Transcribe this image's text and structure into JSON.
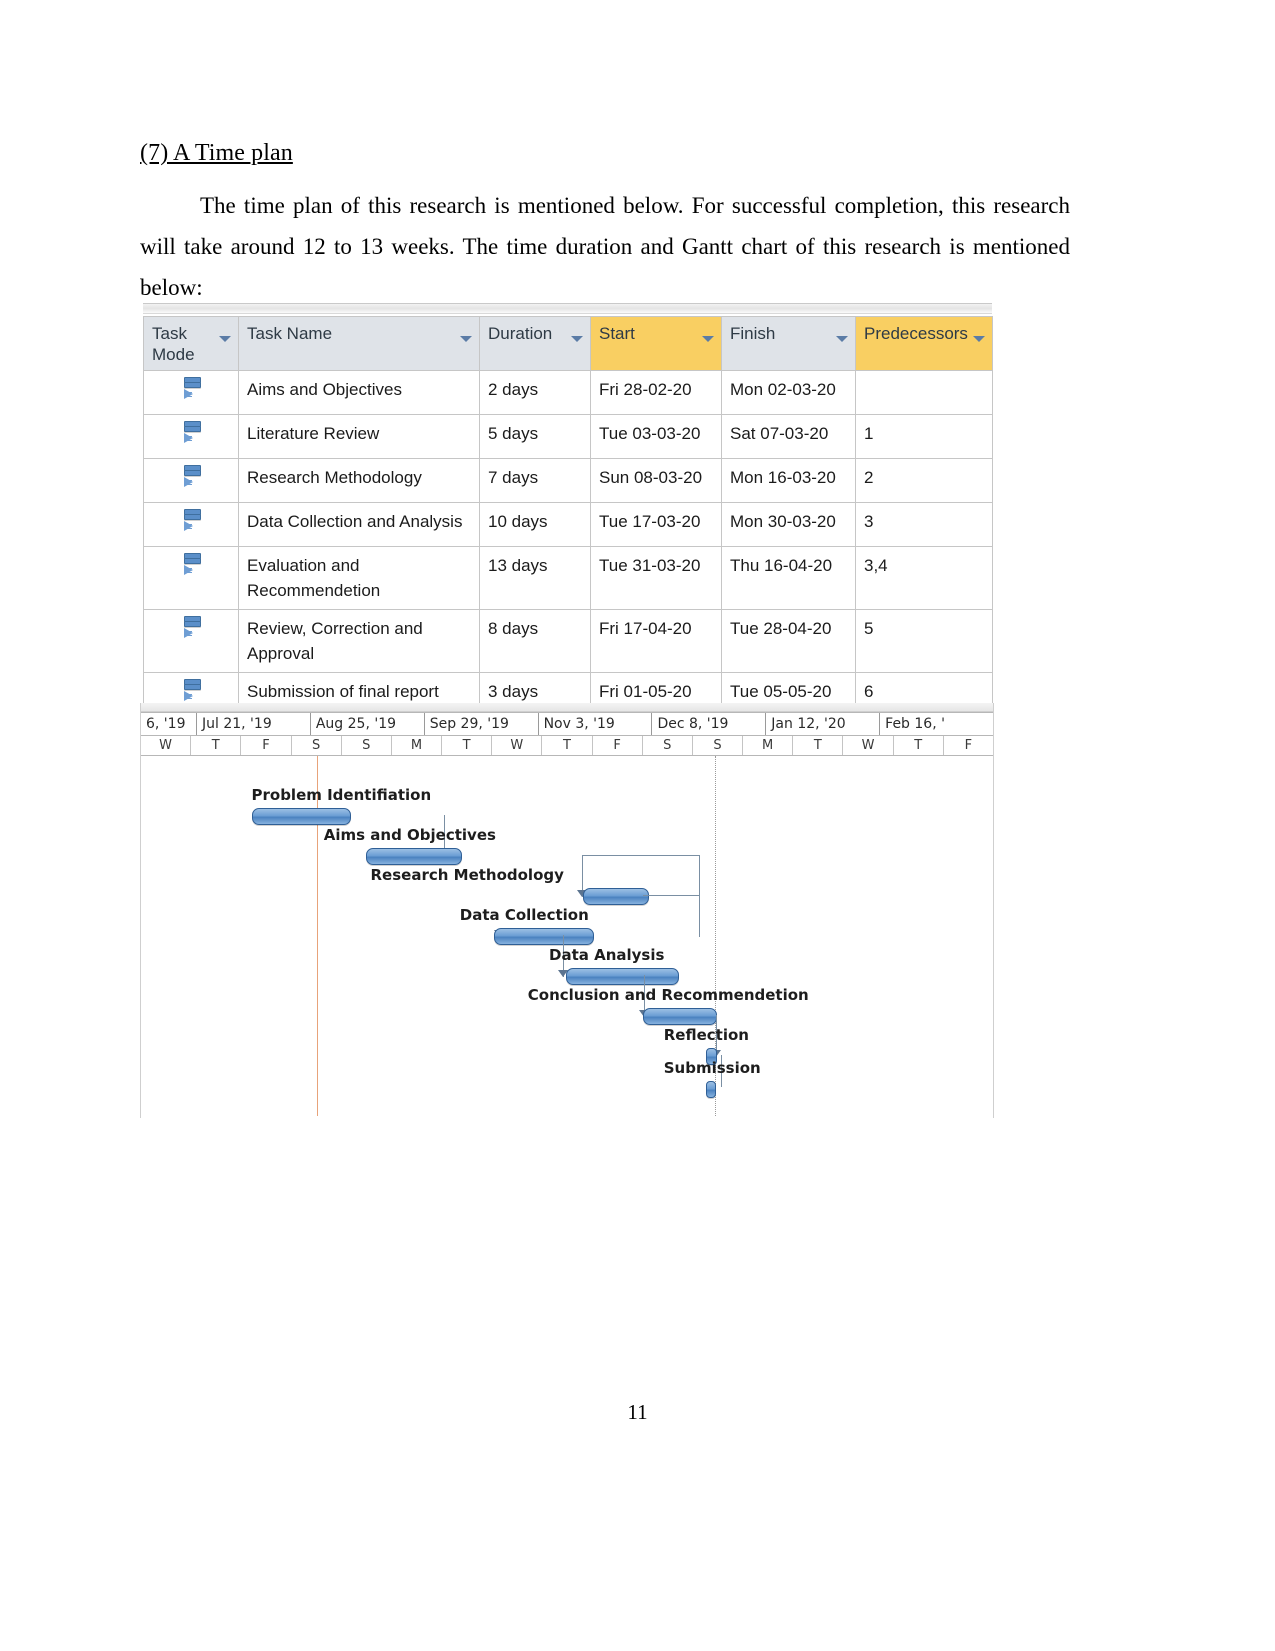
{
  "document": {
    "heading": "(7) A Time plan",
    "paragraph": "The time plan of this research is mentioned below. For successful completion, this research will take around 12 to 13 weeks. The time duration and Gantt chart of this research is mentioned below:",
    "page_number": "11"
  },
  "task_table": {
    "columns": [
      {
        "label": "Task Mode",
        "highlighted": false
      },
      {
        "label": "Task Name",
        "highlighted": false
      },
      {
        "label": "Duration",
        "highlighted": false
      },
      {
        "label": "Start",
        "highlighted": true
      },
      {
        "label": "Finish",
        "highlighted": false
      },
      {
        "label": "Predecessors",
        "highlighted": true
      }
    ],
    "rows": [
      {
        "mode_icon": "manually-scheduled-icon",
        "name": "Aims and Objectives",
        "duration": "2 days",
        "start": "Fri 28-02-20",
        "finish": "Mon 02-03-20",
        "predecessors": ""
      },
      {
        "mode_icon": "manually-scheduled-icon",
        "name": "Literature Review",
        "duration": "5 days",
        "start": "Tue 03-03-20",
        "finish": "Sat 07-03-20",
        "predecessors": "1"
      },
      {
        "mode_icon": "manually-scheduled-icon",
        "name": "Research Methodology",
        "duration": "7 days",
        "start": "Sun 08-03-20",
        "finish": "Mon 16-03-20",
        "predecessors": "2"
      },
      {
        "mode_icon": "manually-scheduled-icon",
        "name": "Data Collection and Analysis",
        "duration": "10 days",
        "start": "Tue 17-03-20",
        "finish": "Mon 30-03-20",
        "predecessors": "3"
      },
      {
        "mode_icon": "manually-scheduled-icon",
        "name": "Evaluation and Recommendetion",
        "duration": "13 days",
        "start": "Tue 31-03-20",
        "finish": "Thu 16-04-20",
        "predecessors": "3,4"
      },
      {
        "mode_icon": "manually-scheduled-icon",
        "name": "Review, Correction and Approval",
        "duration": "8 days",
        "start": "Fri 17-04-20",
        "finish": "Tue 28-04-20",
        "predecessors": "5"
      },
      {
        "mode_icon": "manually-scheduled-icon",
        "name": "Submission of final report",
        "duration": "3 days",
        "start": "Fri 01-05-20",
        "finish": "Tue 05-05-20",
        "predecessors": "6"
      }
    ]
  },
  "chart_data": {
    "type": "bar",
    "title": "Gantt chart",
    "xlabel": "",
    "ylabel": "",
    "grid": false,
    "legend": "none",
    "timeline_months": [
      "6, '19",
      "Jul 21, '19",
      "Aug 25, '19",
      "Sep 29, '19",
      "Nov 3, '19",
      "Dec 8, '19",
      "Jan 12, '20",
      "Feb 16, '"
    ],
    "timeline_days": [
      "W",
      "T",
      "F",
      "S",
      "S",
      "M",
      "T",
      "W",
      "T",
      "F",
      "S",
      "S",
      "M",
      "T",
      "W",
      "T",
      "F"
    ],
    "categories": [
      "Problem Identifiation",
      "Aims and Objectives",
      "Research Methodology",
      "Data Collection",
      "Data Analysis",
      "Conclusion and Recommendetion",
      "Reflection",
      "Submission"
    ],
    "bars": [
      {
        "label": "Problem Identifiation",
        "start_pct": 13.0,
        "width_pct": 11.5,
        "label_x_pct": 13.0,
        "row": 0
      },
      {
        "label": "Aims and Objectives",
        "start_pct": 26.5,
        "width_pct": 11.0,
        "label_x_pct": 21.5,
        "row": 1
      },
      {
        "label": "Research Methodology",
        "start_pct": 52.0,
        "width_pct": 7.5,
        "label_x_pct": 27.0,
        "row": 2
      },
      {
        "label": "Data Collection",
        "start_pct": 41.5,
        "width_pct": 11.5,
        "label_x_pct": 37.5,
        "row": 3
      },
      {
        "label": "Data Analysis",
        "start_pct": 50.0,
        "width_pct": 13.0,
        "label_x_pct": 48.0,
        "row": 4
      },
      {
        "label": "Conclusion and Recommendetion",
        "start_pct": 59.0,
        "width_pct": 8.5,
        "label_x_pct": 45.5,
        "row": 5
      },
      {
        "label": "Reflection",
        "start_pct": 66.5,
        "width_pct": 1.0,
        "label_x_pct": 61.5,
        "row": 6
      },
      {
        "label": "Submission",
        "start_pct": 66.5,
        "width_pct": 0.9,
        "label_x_pct": 61.5,
        "row": 7
      }
    ],
    "markers": [
      {
        "name": "today-line-orange",
        "x_pct": 20.7,
        "style": "solid",
        "color": "#e8a37a"
      },
      {
        "name": "status-line-dotted",
        "x_pct": 67.5,
        "style": "dotted",
        "color": "#9a9a9a"
      }
    ]
  }
}
